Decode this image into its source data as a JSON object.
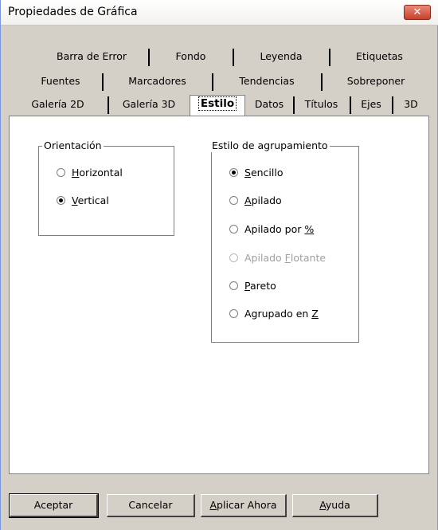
{
  "window": {
    "title": "Propiedades de Gráfica",
    "close_glyph": "✕"
  },
  "tabs": {
    "row1": [
      "Barra de Error",
      "Fondo",
      "Leyenda",
      "Etiquetas"
    ],
    "row2": [
      "Fuentes",
      "Marcadores",
      "Tendencias",
      "Sobreponer"
    ],
    "row3": [
      "Galería 2D",
      "Galería 3D",
      "Estilo",
      "Datos",
      "Títulos",
      "Ejes",
      "3D"
    ],
    "selected": "Estilo"
  },
  "orientation": {
    "label": "Orientación",
    "options": [
      {
        "pre": "",
        "key": "H",
        "post": "orizontal",
        "selected": false
      },
      {
        "pre": "",
        "key": "V",
        "post": "ertical",
        "selected": true
      }
    ]
  },
  "grouping": {
    "label": "Estilo de agrupamiento",
    "options": [
      {
        "pre": "",
        "key": "S",
        "post": "encillo",
        "selected": true,
        "disabled": false
      },
      {
        "pre": "",
        "key": "A",
        "post": "pilado",
        "selected": false,
        "disabled": false
      },
      {
        "pre": "Apilado por ",
        "key": "%",
        "post": "",
        "selected": false,
        "disabled": false
      },
      {
        "pre": "Apilado ",
        "key": "F",
        "post": "lotante",
        "selected": false,
        "disabled": true
      },
      {
        "pre": "",
        "key": "P",
        "post": "areto",
        "selected": false,
        "disabled": false
      },
      {
        "pre": "Agrupado en ",
        "key": "Z",
        "post": "",
        "selected": false,
        "disabled": false
      }
    ]
  },
  "buttons": [
    {
      "pre": "Aceptar",
      "key": "",
      "post": ""
    },
    {
      "pre": "Cancelar",
      "key": "",
      "post": ""
    },
    {
      "pre": "",
      "key": "A",
      "post": "plicar Ahora"
    },
    {
      "pre": "",
      "key": "A",
      "post": "yuda"
    }
  ]
}
